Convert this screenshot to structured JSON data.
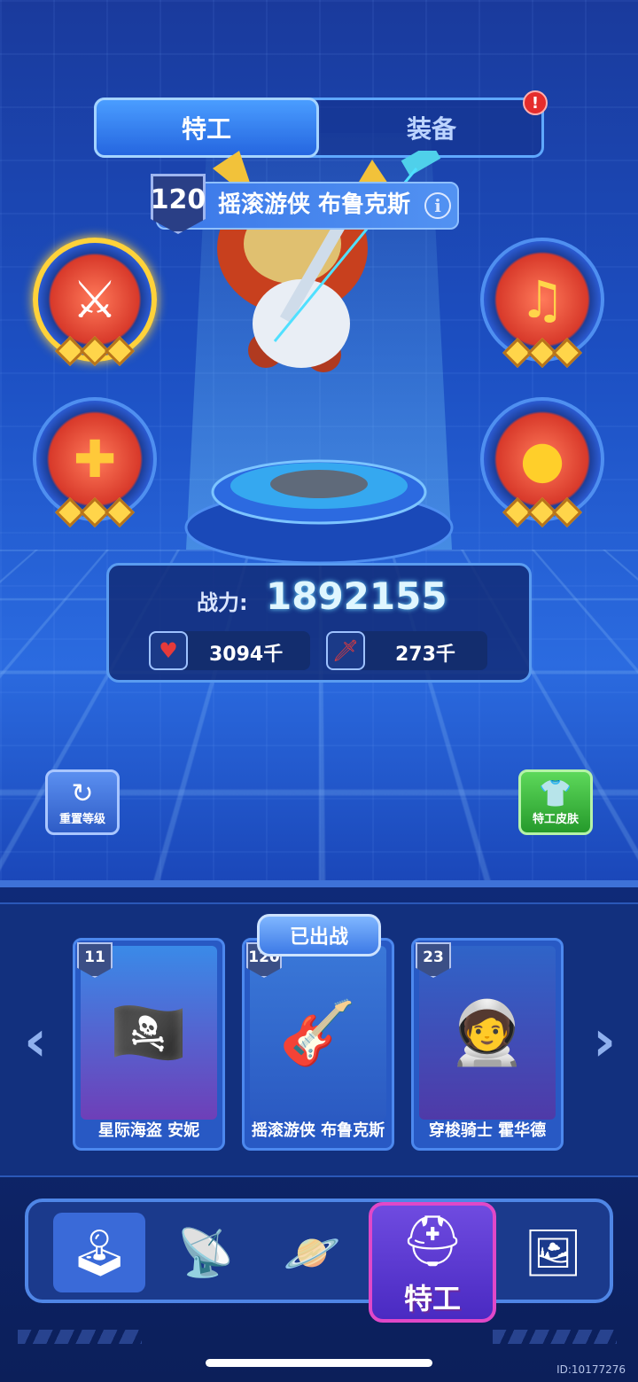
{
  "tabs": {
    "agent": "特工",
    "equipment": "装备",
    "equipment_alert": "!"
  },
  "hero": {
    "level": "120",
    "name": "摇滚游侠 布鲁克斯",
    "info": "i"
  },
  "skills": [
    {
      "icon": "sword-burst-icon",
      "stars": 3,
      "active": true
    },
    {
      "icon": "music-notes-icon",
      "stars": 3,
      "active": false
    },
    {
      "icon": "gold-plus-icon",
      "stars": 3,
      "active": false
    },
    {
      "icon": "gold-orb-icon",
      "stars": 3,
      "active": false
    }
  ],
  "power": {
    "label": "战力:",
    "value": "1892155",
    "hp": "3094千",
    "attack": "273千"
  },
  "buttons": {
    "reset": "重置等级",
    "skin": "特工皮肤"
  },
  "roster": {
    "deployed_label": "已出战",
    "cards": [
      {
        "level": "11",
        "name": "星际海盗 安妮",
        "portrait": "pirate-portrait-icon"
      },
      {
        "level": "120",
        "name": "摇滚游侠 布鲁克斯",
        "portrait": "rocker-portrait-icon"
      },
      {
        "level": "23",
        "name": "穿梭骑士 霍华德",
        "portrait": "astronaut-portrait-icon"
      }
    ]
  },
  "nav": {
    "active_label": "特工",
    "items": [
      "arcade-machine-icon",
      "radar-icon",
      "planet-icon",
      "agent-helmet-icon",
      "frame-gem-icon"
    ]
  },
  "footer": {
    "user_id": "ID:10177276"
  },
  "colors": {
    "accent_blue": "#2566e0",
    "active_gold": "#ffd23a",
    "skin_green": "#259a2b",
    "nav_active": "#e048c8"
  }
}
